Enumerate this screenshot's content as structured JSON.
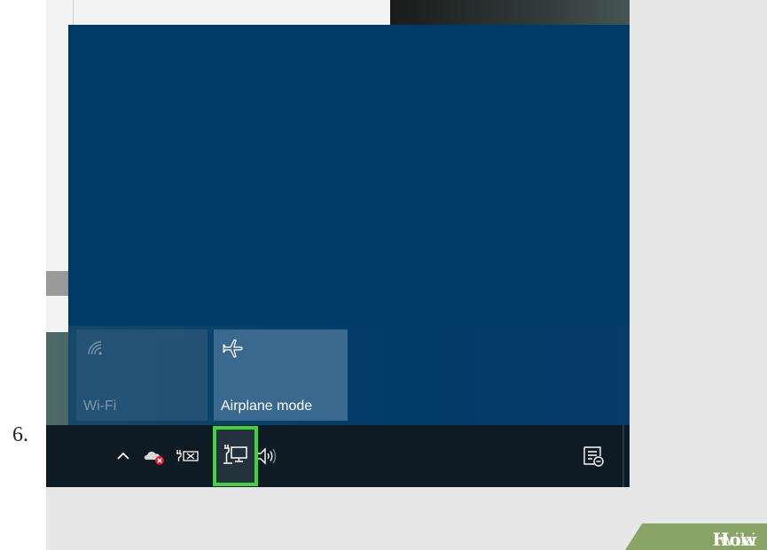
{
  "step": {
    "number": "6."
  },
  "action_center": {
    "tiles": [
      {
        "label": "Wi-Fi",
        "icon": "wifi-icon",
        "state": "off"
      },
      {
        "label": "Airplane mode",
        "icon": "airplane-icon",
        "state": "off"
      }
    ]
  },
  "taskbar": {
    "tray_icons": [
      "chevron-up-icon",
      "onedrive-error-icon",
      "ethernet-disconnected-icon",
      "network-icon",
      "volume-icon",
      "notification-center-icon"
    ],
    "highlighted": "network-icon"
  },
  "watermark": {
    "wiki": "wiki",
    "how": "How"
  },
  "colors": {
    "action_center_bg": "#003b68",
    "tile_bg": "#3a6990",
    "taskbar_bg": "#0f1b24",
    "highlight": "#3fd43b",
    "watermark_bg": "#8aa468"
  }
}
